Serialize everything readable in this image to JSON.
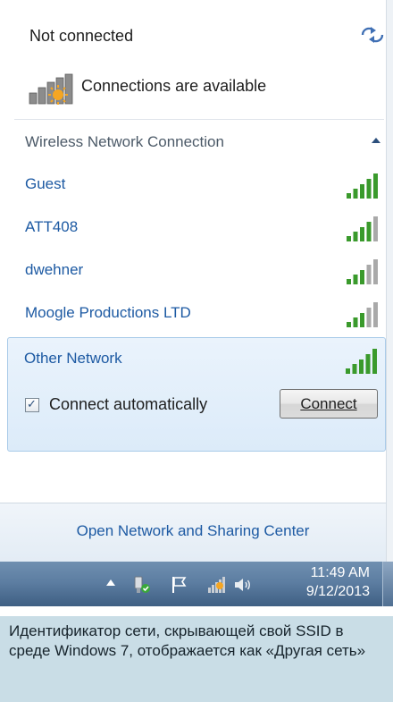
{
  "flyout": {
    "status": "Not connected",
    "availability": "Connections are available",
    "section": "Wireless Network Connection",
    "networks": [
      {
        "name": "Guest",
        "signal_bars": 5
      },
      {
        "name": "ATT408",
        "signal_bars": 4
      },
      {
        "name": "dwehner",
        "signal_bars": 3
      },
      {
        "name": "Moogle Productions LTD",
        "signal_bars": 3
      }
    ],
    "selected": {
      "name": "Other Network",
      "signal_bars": 5,
      "auto_connect_label": "Connect automatically",
      "auto_connect_checked": true,
      "connect_button": "Connect"
    },
    "footer_link": "Open Network and Sharing Center"
  },
  "taskbar": {
    "time": "11:49 AM",
    "date": "9/12/2013",
    "tray_icons": [
      "show-hidden-icons-arrow",
      "safely-remove-hardware-icon",
      "action-center-flag-icon",
      "network-status-icon",
      "volume-icon"
    ]
  },
  "caption": "Идентификатор сети, скрывающей свой SSID в среде Windows 7, отображается как «Другая сеть»",
  "colors": {
    "link_blue": "#1d5aa3",
    "signal_green": "#3a9a2c",
    "signal_grey": "#a9a9a9",
    "taskbar": "#5d7ea2",
    "caption_bg": "#c9dde6"
  }
}
